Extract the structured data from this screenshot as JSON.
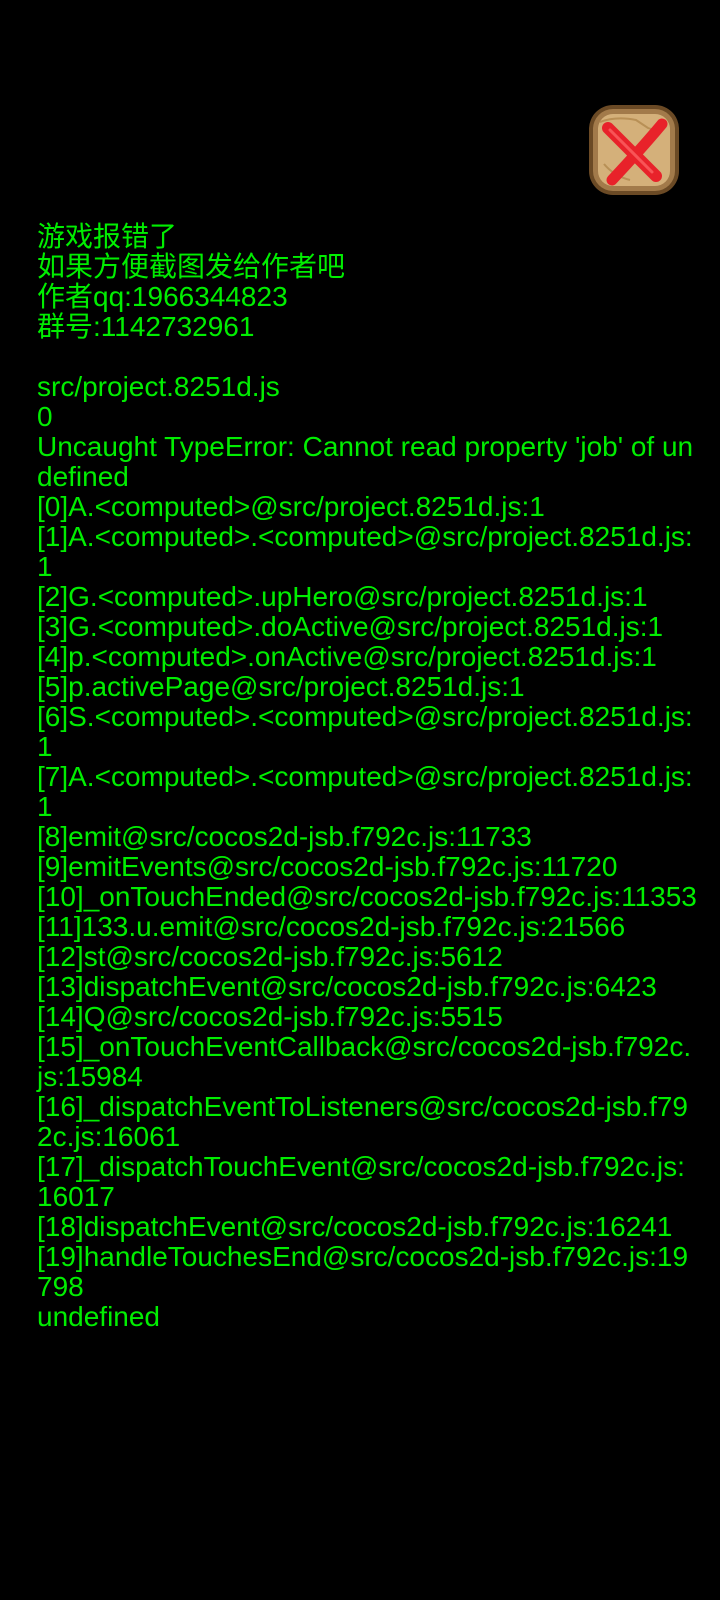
{
  "colors": {
    "background": "#000000",
    "text": "#00ee00",
    "close_button_frame": "#a27a4a",
    "close_button_fill": "#d4b07a",
    "close_icon": "#e8222a"
  },
  "close_button": {
    "icon": "red-x-icon"
  },
  "error_log": {
    "header": [
      "游戏报错了",
      "如果方便截图发给作者吧",
      "作者qq:1966344823",
      "群号:1142732961"
    ],
    "file": "src/project.8251d.js",
    "code": "0",
    "message": "Uncaught TypeError: Cannot read property 'job' of undefined",
    "stack": [
      "[0]A.<computed>@src/project.8251d.js:1",
      "[1]A.<computed>.<computed>@src/project.8251d.js:1",
      "[2]G.<computed>.upHero@src/project.8251d.js:1",
      "[3]G.<computed>.doActive@src/project.8251d.js:1",
      "[4]p.<computed>.onActive@src/project.8251d.js:1",
      "[5]p.activePage@src/project.8251d.js:1",
      "[6]S.<computed>.<computed>@src/project.8251d.js:1",
      "[7]A.<computed>.<computed>@src/project.8251d.js:1",
      "[8]emit@src/cocos2d-jsb.f792c.js:11733",
      "[9]emitEvents@src/cocos2d-jsb.f792c.js:11720",
      "[10]_onTouchEnded@src/cocos2d-jsb.f792c.js:11353",
      "[11]133.u.emit@src/cocos2d-jsb.f792c.js:21566",
      "[12]st@src/cocos2d-jsb.f792c.js:5612",
      "[13]dispatchEvent@src/cocos2d-jsb.f792c.js:6423",
      "[14]Q@src/cocos2d-jsb.f792c.js:5515",
      "[15]_onTouchEventCallback@src/cocos2d-jsb.f792c.js:15984",
      "[16]_dispatchEventToListeners@src/cocos2d-jsb.f792c.js:16061",
      "[17]_dispatchTouchEvent@src/cocos2d-jsb.f792c.js:16017",
      "[18]dispatchEvent@src/cocos2d-jsb.f792c.js:16241",
      "[19]handleTouchesEnd@src/cocos2d-jsb.f792c.js:19798"
    ],
    "footer": "undefined"
  }
}
